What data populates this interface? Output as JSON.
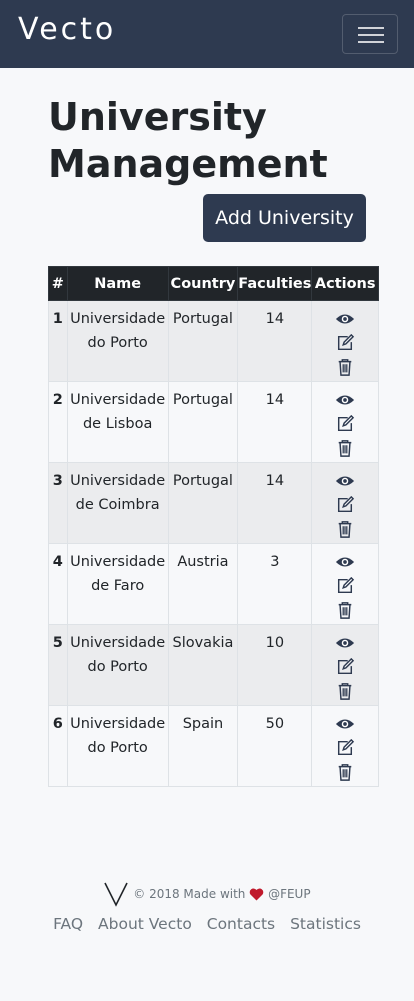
{
  "navbar": {
    "brand": "Vecto"
  },
  "page": {
    "title": "University Management",
    "add_button": "Add University"
  },
  "table": {
    "headers": [
      "#",
      "Name",
      "Country",
      "Faculties",
      "Actions"
    ],
    "rows": [
      {
        "num": "1",
        "name": "Universidade do Porto",
        "country": "Portugal",
        "faculties": "14"
      },
      {
        "num": "2",
        "name": "Universidade de Lisboa",
        "country": "Portugal",
        "faculties": "14"
      },
      {
        "num": "3",
        "name": "Universidade de Coimbra",
        "country": "Portugal",
        "faculties": "14"
      },
      {
        "num": "4",
        "name": "Universidade de Faro",
        "country": "Austria",
        "faculties": "3"
      },
      {
        "num": "5",
        "name": "Universidade do Porto",
        "country": "Slovakia",
        "faculties": "10"
      },
      {
        "num": "6",
        "name": "Universidade do Porto",
        "country": "Spain",
        "faculties": "50"
      }
    ],
    "action_icons": [
      "eye-icon",
      "edit-icon",
      "trash-icon"
    ]
  },
  "footer": {
    "copyright_prefix": "© 2018 Made with",
    "copyright_suffix": "@FEUP",
    "links": [
      "FAQ",
      "About Vecto",
      "Contacts",
      "Statistics"
    ]
  },
  "colors": {
    "navbar": "#2e3a50",
    "button": "#2e3a50",
    "table_header": "#212529",
    "heart": "#c0192c"
  }
}
